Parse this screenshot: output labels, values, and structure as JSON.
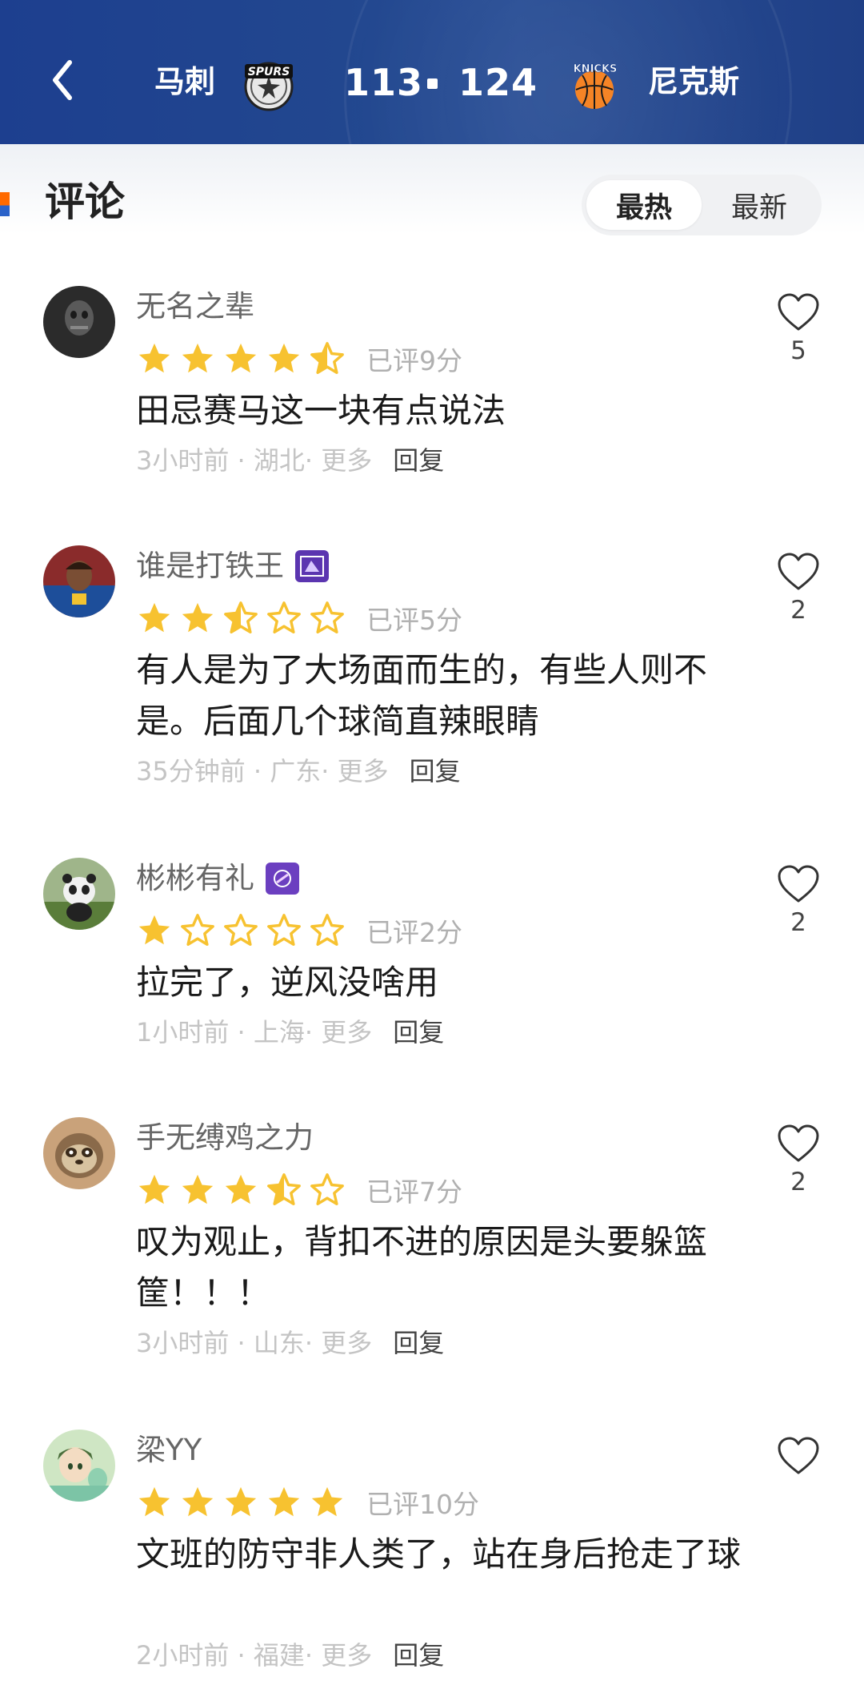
{
  "header": {
    "home_team": "马刺",
    "away_team": "尼克斯",
    "home_score": "113",
    "away_score": "124",
    "home_logo_text": "SPURS",
    "away_logo_text": "KNICKS"
  },
  "section": {
    "title": "评论",
    "sort_options": [
      "最热",
      "最新"
    ],
    "active_sort": "最热"
  },
  "colors": {
    "header_bg": "#22478f",
    "star_fill": "#f7c230",
    "accent_orange": "#ff6a00",
    "badge_purple": "#6b3fc0"
  },
  "comments": [
    {
      "user": "无名之辈",
      "rating": 4.5,
      "rated_label": "已评9分",
      "text": "田忌赛马这一块有点说法",
      "time": "3小时前",
      "location": "湖北",
      "more": "更多",
      "reply": "回复",
      "likes": "5",
      "badge": null
    },
    {
      "user": "谁是打铁王",
      "rating": 2.5,
      "rated_label": "已评5分",
      "text": "有人是为了大场面而生的，有些人则不是。后面几个球简直辣眼睛",
      "time": "35分钟前",
      "location": "广东",
      "more": "更多",
      "reply": "回复",
      "likes": "2",
      "badge": "team-badge-icon"
    },
    {
      "user": "彬彬有礼",
      "rating": 1,
      "rated_label": "已评2分",
      "text": "拉完了，逆风没啥用",
      "time": "1小时前",
      "location": "上海",
      "more": "更多",
      "reply": "回复",
      "likes": "2",
      "badge": "team-badge-icon"
    },
    {
      "user": "手无缚鸡之力",
      "rating": 3.5,
      "rated_label": "已评7分",
      "text": "叹为观止，背扣不进的原因是头要躲篮筐！！！",
      "time": "3小时前",
      "location": "山东",
      "more": "更多",
      "reply": "回复",
      "likes": "2",
      "badge": null
    },
    {
      "user": "梁YY",
      "rating": 5,
      "rated_label": "已评10分",
      "text": "文班的防守非人类了，站在身后抢走了球",
      "time": "2小时前",
      "location": "福建",
      "more": "更多",
      "reply": "回复",
      "likes": "",
      "badge": null
    }
  ]
}
